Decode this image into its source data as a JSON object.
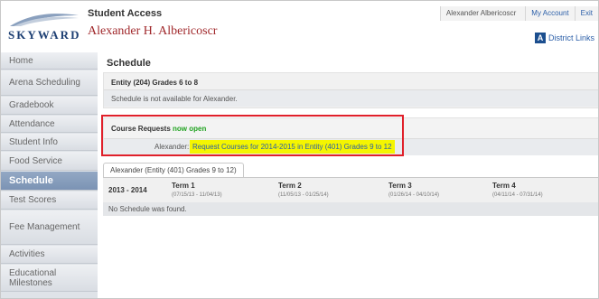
{
  "header": {
    "logo_text": "SKYWARD",
    "app_title": "Student Access",
    "student_name": "Alexander H. Albericoscr",
    "user_name": "Alexander Albericoscr",
    "my_account": "My Account",
    "exit": "Exit",
    "district_links": "District Links",
    "district_icon_glyph": "A"
  },
  "sidebar": {
    "items": [
      {
        "label": "Home"
      },
      {
        "label": "Arena Scheduling"
      },
      {
        "label": "Gradebook"
      },
      {
        "label": "Attendance"
      },
      {
        "label": "Student Info"
      },
      {
        "label": "Food Service"
      },
      {
        "label": "Schedule",
        "active": true
      },
      {
        "label": "Test Scores"
      },
      {
        "label": "Fee Management"
      },
      {
        "label": "Activities"
      },
      {
        "label": "Educational Milestones"
      }
    ]
  },
  "main": {
    "page_title": "Schedule",
    "entity_title": "Entity (204) Grades 6 to 8",
    "entity_message": "Schedule is not available for Alexander.",
    "course_requests_title": "Course Requests",
    "course_requests_status": "now open",
    "course_requests_student_label": "Alexander:",
    "course_requests_link": "Request Courses for 2014-2015 in Entity (401) Grades 9 to 12",
    "tab_label": "Alexander  (Entity (401) Grades 9 to 12)",
    "year": "2013 - 2014",
    "terms": [
      {
        "name": "Term 1",
        "dates": "(07/15/13 - 11/04/13)"
      },
      {
        "name": "Term 2",
        "dates": "(11/05/13 - 01/25/14)"
      },
      {
        "name": "Term 3",
        "dates": "(01/26/14 - 04/10/14)"
      },
      {
        "name": "Term 4",
        "dates": "(04/11/14 - 07/31/14)"
      }
    ],
    "no_schedule": "No Schedule was found."
  },
  "colors": {
    "accent_red": "#a0282b",
    "highlight_border": "#e0202a",
    "highlight_fill": "#f5f500",
    "link_blue": "#2a5ea8",
    "active_nav": "#7b93b4"
  }
}
